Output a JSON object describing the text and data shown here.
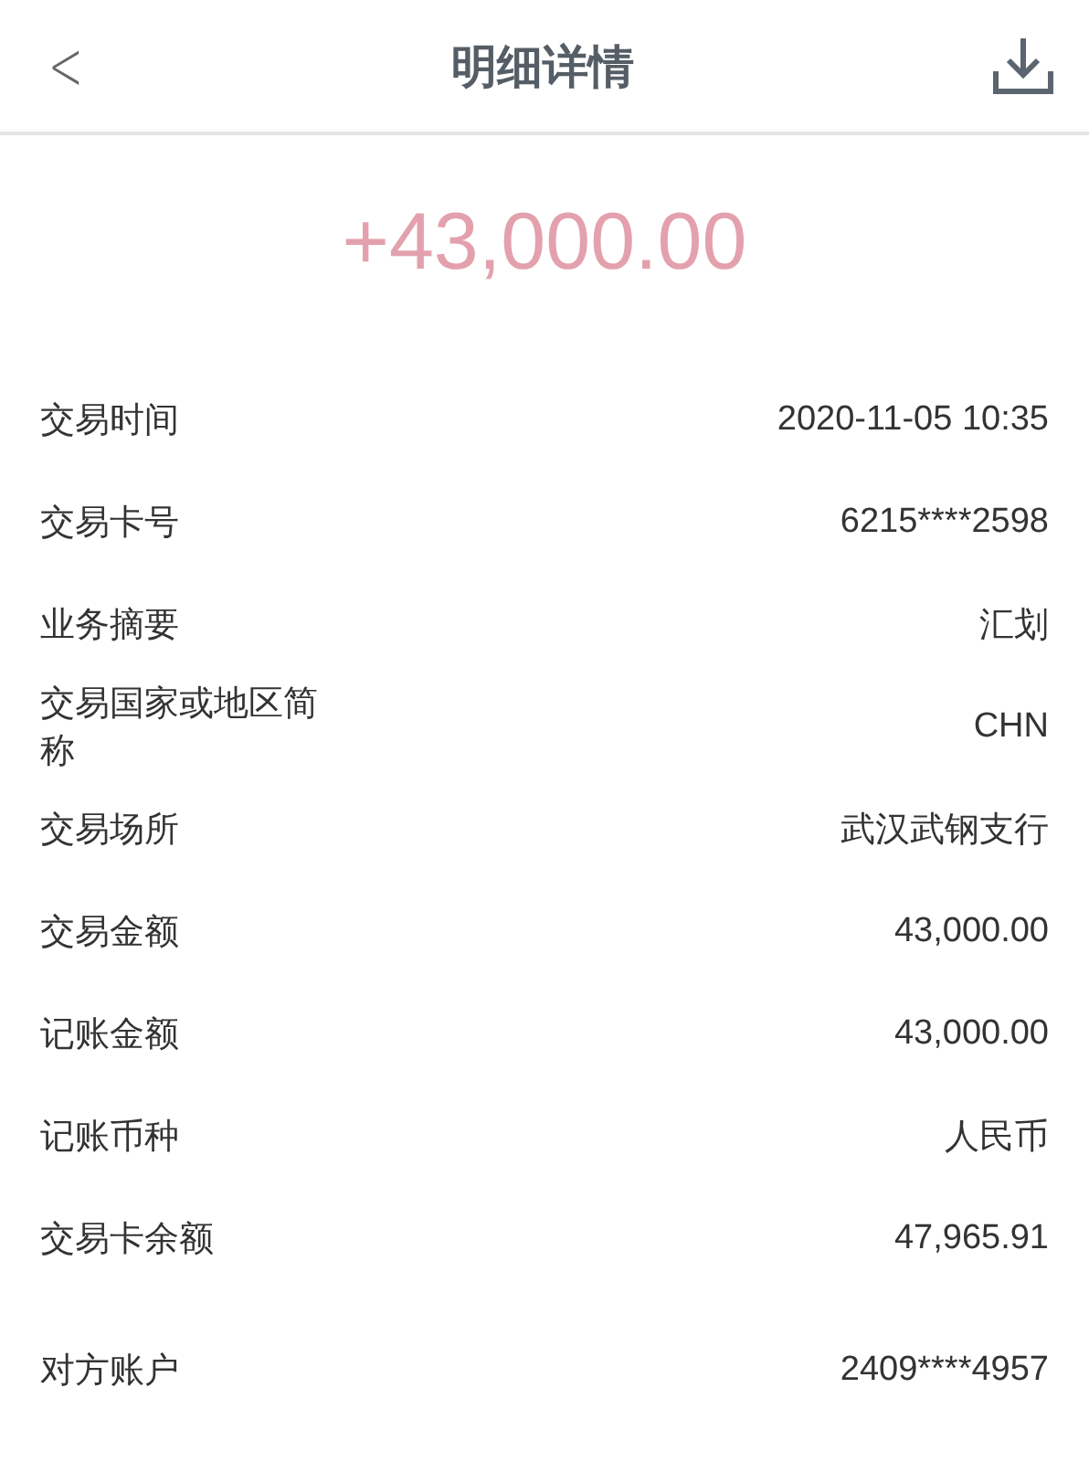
{
  "header": {
    "back": "<",
    "title": "明细详情"
  },
  "amount": "+43,000.00",
  "rows": [
    {
      "label": "交易时间",
      "value": "2020-11-05 10:35"
    },
    {
      "label": "交易卡号",
      "value": "6215****2598"
    },
    {
      "label": "业务摘要",
      "value": "汇划"
    },
    {
      "label": "交易国家或地区简称",
      "value": "CHN"
    },
    {
      "label": "交易场所",
      "value": "武汉武钢支行"
    },
    {
      "label": "交易金额",
      "value": "43,000.00"
    },
    {
      "label": "记账金额",
      "value": "43,000.00"
    },
    {
      "label": "记账币种",
      "value": "人民币"
    },
    {
      "label": "交易卡余额",
      "value": "47,965.91"
    },
    {
      "label": "对方账户",
      "value": "2409****4957"
    }
  ]
}
